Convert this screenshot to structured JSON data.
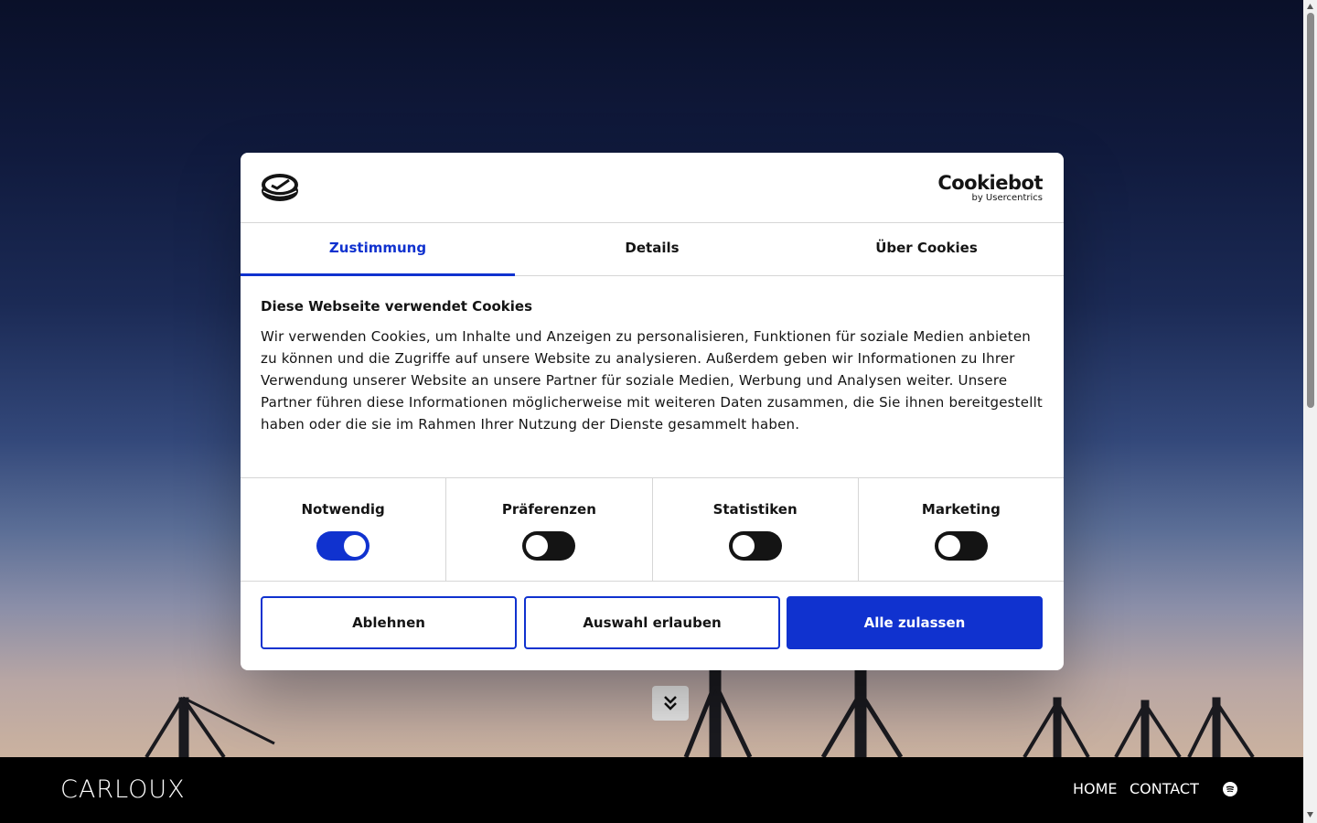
{
  "dialog": {
    "brand": {
      "name": "Cookiebot",
      "by": "by Usercentrics"
    },
    "tabs": [
      {
        "label": "Zustimmung",
        "active": true
      },
      {
        "label": "Details",
        "active": false
      },
      {
        "label": "Über Cookies",
        "active": false
      }
    ],
    "title": "Diese Webseite verwendet Cookies",
    "text": "Wir verwenden Cookies, um Inhalte und Anzeigen zu personalisieren, Funktionen für soziale Medien anbieten zu können und die Zugriffe auf unsere Website zu analysieren. Außerdem geben wir Informationen zu Ihrer Verwendung unserer Website an unsere Partner für soziale Medien, Werbung und Analysen weiter. Unsere Partner führen diese Informationen möglicherweise mit weiteren Daten zusammen, die Sie ihnen bereitgestellt haben oder die sie im Rahmen Ihrer Nutzung der Dienste gesammelt haben.",
    "toggles": [
      {
        "label": "Notwendig",
        "on": true
      },
      {
        "label": "Präferenzen",
        "on": false
      },
      {
        "label": "Statistiken",
        "on": false
      },
      {
        "label": "Marketing",
        "on": false
      }
    ],
    "buttons": {
      "decline": "Ablehnen",
      "selection": "Auswahl erlauben",
      "all": "Alle zulassen"
    }
  },
  "footer": {
    "logo": "CARLOUX",
    "nav": {
      "home": "HOME",
      "contact": "CONTACT"
    },
    "social_icon": "spotify-icon"
  },
  "colors": {
    "accent": "#1032cf",
    "text": "#141414",
    "footer_bg": "#000000"
  }
}
